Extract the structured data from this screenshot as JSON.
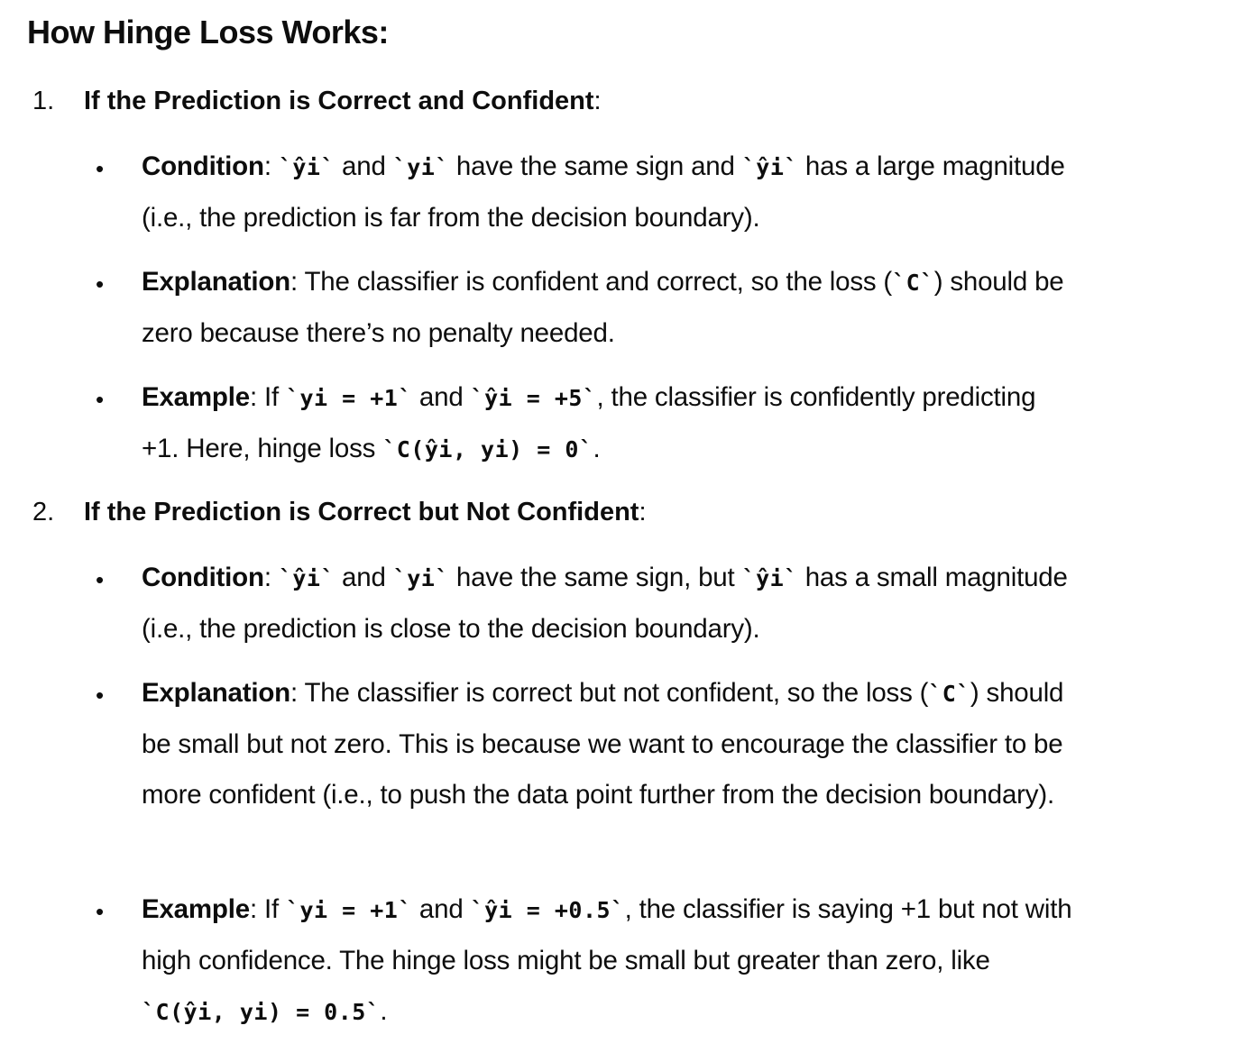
{
  "heading": "How Hinge Loss Works:",
  "sections": [
    {
      "number": "1.",
      "title": "If the Prediction is Correct and Confident",
      "bullets": [
        {
          "label": "Condition",
          "parts": [
            ": ",
            "`ŷi`",
            " and ",
            "`yi`",
            " have the same sign and ",
            "`ŷi`",
            " has a large magnitude (i.e., the prediction is far from the decision boundary)."
          ]
        },
        {
          "label": "Explanation",
          "parts": [
            ": The classifier is confident and correct, so the loss (",
            "`C`",
            ") should be zero because there’s no penalty needed."
          ]
        },
        {
          "label": "Example",
          "parts": [
            ": If ",
            "`yi = +1`",
            " and ",
            "`ŷi = +5`",
            ", the classifier is confidently predicting +1. Here, hinge loss ",
            "`C(ŷi, yi) = 0`",
            "."
          ]
        }
      ]
    },
    {
      "number": "2.",
      "title": "If the Prediction is Correct but Not Confident",
      "bullets": [
        {
          "label": "Condition",
          "parts": [
            ": ",
            "`ŷi`",
            " and ",
            "`yi`",
            " have the same sign, but ",
            "`ŷi`",
            " has a small magnitude (i.e., the prediction is close to the decision boundary)."
          ]
        },
        {
          "label": "Explanation",
          "parts": [
            ": The classifier is correct but not confident, so the loss (",
            "`C`",
            ") should be small but not zero. This is because we want to encourage the classifier to be more confident (i.e., to push the data point further from the decision boundary)."
          ]
        },
        {
          "label": "Example",
          "parts": [
            ": If ",
            "`yi = +1`",
            " and ",
            "`ŷi = +0.5`",
            ", the classifier is saying +1 but not with high confidence. The hinge loss might be small but greater than zero, like ",
            "`C(ŷi, yi) = 0.5`",
            "."
          ]
        }
      ]
    }
  ]
}
